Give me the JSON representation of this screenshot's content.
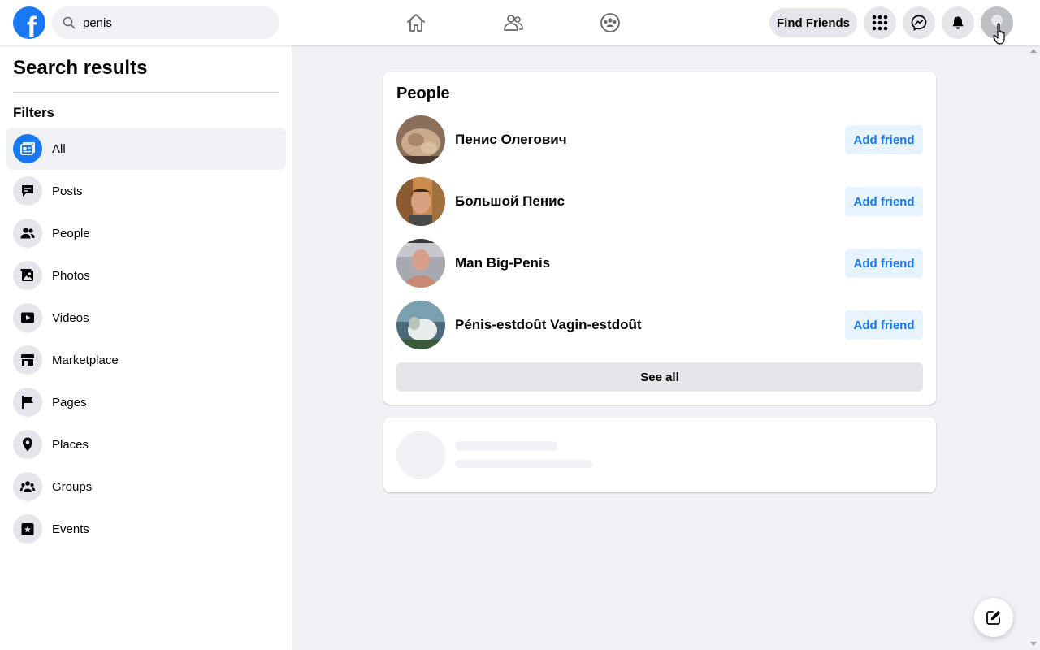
{
  "colors": {
    "brand": "#1877f2",
    "background": "#f0f2f5",
    "surface": "#ffffff",
    "add_friend_bg": "#e7f3ff"
  },
  "header": {
    "logo_letter": "f",
    "search_value": "penis",
    "find_friends_label": "Find Friends",
    "nav_icons": [
      "home-icon",
      "friends-icon",
      "groups-icon"
    ],
    "right_icons": [
      "menu-grid-icon",
      "messenger-icon",
      "notifications-icon",
      "account-avatar"
    ]
  },
  "sidebar": {
    "title": "Search results",
    "filters_heading": "Filters",
    "items": [
      {
        "label": "All",
        "icon": "all-results-icon",
        "active": true
      },
      {
        "label": "Posts",
        "icon": "posts-icon"
      },
      {
        "label": "People",
        "icon": "people-icon"
      },
      {
        "label": "Photos",
        "icon": "photos-icon"
      },
      {
        "label": "Videos",
        "icon": "videos-icon"
      },
      {
        "label": "Marketplace",
        "icon": "marketplace-icon"
      },
      {
        "label": "Pages",
        "icon": "pages-icon"
      },
      {
        "label": "Places",
        "icon": "places-icon"
      },
      {
        "label": "Groups",
        "icon": "groups-icon"
      },
      {
        "label": "Events",
        "icon": "events-icon"
      }
    ]
  },
  "people": {
    "heading": "People",
    "results": [
      {
        "name": "Пенис Олегович",
        "action": "Add friend"
      },
      {
        "name": "Большой Пенис",
        "action": "Add friend"
      },
      {
        "name": "Man Big-Penis",
        "action": "Add friend"
      },
      {
        "name": "Pénis-estdoût Vagin-estdoût",
        "action": "Add friend"
      }
    ],
    "see_all_label": "See all"
  },
  "floating": {
    "new_message_icon": "compose-icon"
  }
}
